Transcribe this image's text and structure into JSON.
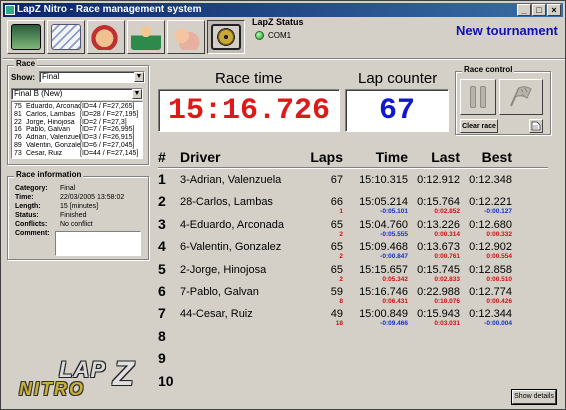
{
  "window": {
    "title": "LapZ Nitro - Race management system"
  },
  "status": {
    "title": "LapZ Status",
    "port": "COM1"
  },
  "tournament": "New tournament",
  "race_group": {
    "title": "Race",
    "show_label": "Show:",
    "show_value": "Final",
    "race_select": "Final B (New)",
    "entries": [
      {
        "num": "75",
        "name": "Eduardo, Arconada",
        "info": "[ID=4 / F=27,265]"
      },
      {
        "num": "81",
        "name": "Carlos, Lambas",
        "info": "[ID=28 / F=27,195]"
      },
      {
        "num": "22",
        "name": "Jorge, Hinojosa",
        "info": "[ID=2 / F=27,3]"
      },
      {
        "num": "16",
        "name": "Pablo, Galvan",
        "info": "[ID=7 / F=26,995]"
      },
      {
        "num": "76",
        "name": "Adrian, Valenzuela",
        "info": "[ID=3 / F=26,915]"
      },
      {
        "num": "89",
        "name": "Valentin, Gonzalez",
        "info": "[ID=6 / F=27,045]"
      },
      {
        "num": "73",
        "name": "Cesar, Ruiz",
        "info": "[ID=44 / F=27,145]"
      }
    ]
  },
  "race_info": {
    "title": "Race information",
    "category_label": "Category:",
    "category": "Final",
    "time_label": "Time:",
    "time": "22/03/2005 13:58:02",
    "length_label": "Length:",
    "length": "15 [minutes]",
    "status_label": "Status:",
    "status": "Finished",
    "conflicts_label": "Conflicts:",
    "conflicts": "No conflict",
    "comment_label": "Comment:"
  },
  "race_time": {
    "label": "Race time",
    "value": "15:16.726"
  },
  "lap_counter": {
    "label": "Lap counter",
    "value": "67"
  },
  "race_control": {
    "title": "Race control",
    "clear_label": "Clear race"
  },
  "columns": {
    "pos": "#",
    "driver": "Driver",
    "laps": "Laps",
    "time": "Time",
    "last": "Last",
    "best": "Best"
  },
  "results": [
    {
      "pos": "1",
      "driver": "3-Adrian, Valenzuela",
      "laps": "67",
      "laps_sub": "",
      "time": "15:10.315",
      "time_sub": "",
      "last": "0:12.912",
      "last_sub": "",
      "best": "0:12.348",
      "best_sub": ""
    },
    {
      "pos": "2",
      "driver": "28-Carlos, Lambas",
      "laps": "66",
      "laps_sub": "1",
      "time": "15:05.214",
      "time_sub": "-0:05.101",
      "last": "0:15.764",
      "last_sub": "0:02.852",
      "best": "0:12.221",
      "best_sub": "-0:00.127"
    },
    {
      "pos": "3",
      "driver": "4-Eduardo, Arconada",
      "laps": "65",
      "laps_sub": "2",
      "time": "15:04.760",
      "time_sub": "-0:05.555",
      "last": "0:13.226",
      "last_sub": "0:00.314",
      "best": "0:12.680",
      "best_sub": "0:00.332"
    },
    {
      "pos": "4",
      "driver": "6-Valentin, Gonzalez",
      "laps": "65",
      "laps_sub": "2",
      "time": "15:09.468",
      "time_sub": "-0:00.847",
      "last": "0:13.673",
      "last_sub": "0:00.761",
      "best": "0:12.902",
      "best_sub": "0:00.554"
    },
    {
      "pos": "5",
      "driver": "2-Jorge, Hinojosa",
      "laps": "65",
      "laps_sub": "2",
      "time": "15:15.657",
      "time_sub": "0:05.342",
      "last": "0:15.745",
      "last_sub": "0:02.833",
      "best": "0:12.858",
      "best_sub": "0:00.510"
    },
    {
      "pos": "6",
      "driver": "7-Pablo, Galvan",
      "laps": "59",
      "laps_sub": "8",
      "time": "15:16.746",
      "time_sub": "0:06.431",
      "last": "0:22.988",
      "last_sub": "0:10.076",
      "best": "0:12.774",
      "best_sub": "0:00.426"
    },
    {
      "pos": "7",
      "driver": "44-Cesar, Ruiz",
      "laps": "49",
      "laps_sub": "18",
      "time": "15:00.849",
      "time_sub": "-0:09.466",
      "last": "0:15.943",
      "last_sub": "0:03.031",
      "best": "0:12.344",
      "best_sub": "-0:00.004"
    },
    {
      "pos": "8",
      "driver": "",
      "laps": "",
      "laps_sub": "",
      "time": "",
      "time_sub": "",
      "last": "",
      "last_sub": "",
      "best": "",
      "best_sub": ""
    },
    {
      "pos": "9",
      "driver": "",
      "laps": "",
      "laps_sub": "",
      "time": "",
      "time_sub": "",
      "last": "",
      "last_sub": "",
      "best": "",
      "best_sub": ""
    },
    {
      "pos": "10",
      "driver": "",
      "laps": "",
      "laps_sub": "",
      "time": "",
      "time_sub": "",
      "last": "",
      "last_sub": "",
      "best": "",
      "best_sub": ""
    }
  ],
  "logo": {
    "lap": "LAP",
    "z": "Z",
    "nitro": "NITRO"
  },
  "show_details_label": "Show details",
  "colors": {
    "race_time": "#e01818",
    "lap_counter": "#1018d0",
    "tournament": "#1010b0",
    "delta_positive": "#d01010",
    "delta_negative": "#1030d0"
  }
}
